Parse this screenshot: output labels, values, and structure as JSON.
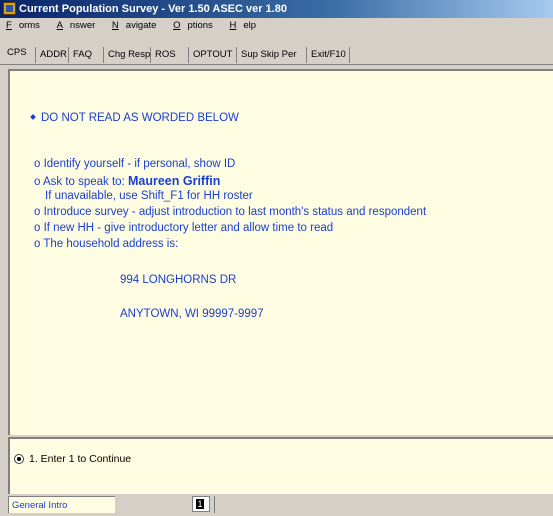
{
  "window": {
    "title": "Current Population Survey - Ver 1.50 ASEC ver 1.80"
  },
  "menu": [
    {
      "label": "Forms",
      "underline": "F",
      "rest": "orms"
    },
    {
      "label": "Answer",
      "underline": "A",
      "rest": "nswer"
    },
    {
      "label": "Navigate",
      "underline": "N",
      "rest": "avigate"
    },
    {
      "label": "Options",
      "underline": "O",
      "rest": "ptions"
    },
    {
      "label": "Help",
      "underline": "H",
      "rest": "elp"
    }
  ],
  "tabs": [
    "CPS",
    "ADDR",
    "FAQ",
    "Chg Resp",
    "ROS",
    "OPTOUT",
    "Sup Skip Per",
    "Exit/F10"
  ],
  "question": {
    "header": "DO NOT READ AS WORDED BELOW",
    "line1": "o Identify yourself - if personal, show ID",
    "line2_prefix": "o Ask to speak to: ",
    "respondent_name": "Maureen Griffin",
    "line3": "If unavailable, use Shift_F1 for HH roster",
    "line4": "o Introduce survey - adjust introduction to last month's status and respondent",
    "line5": "o If new HH - give introductory letter and allow time to read",
    "line6": "o The household address is:",
    "address1": "994  LONGHORNS DR",
    "address2": "ANYTOWN, WI 99997-9997"
  },
  "answers": [
    {
      "label": "1.  Enter 1 to Continue",
      "selected": true
    }
  ],
  "status": {
    "field_name": "General Intro",
    "value": "1"
  },
  "colors": {
    "text_blue": "#1a3fd2",
    "panel_bg": "#fffde1",
    "chrome": "#d4d0c8"
  }
}
